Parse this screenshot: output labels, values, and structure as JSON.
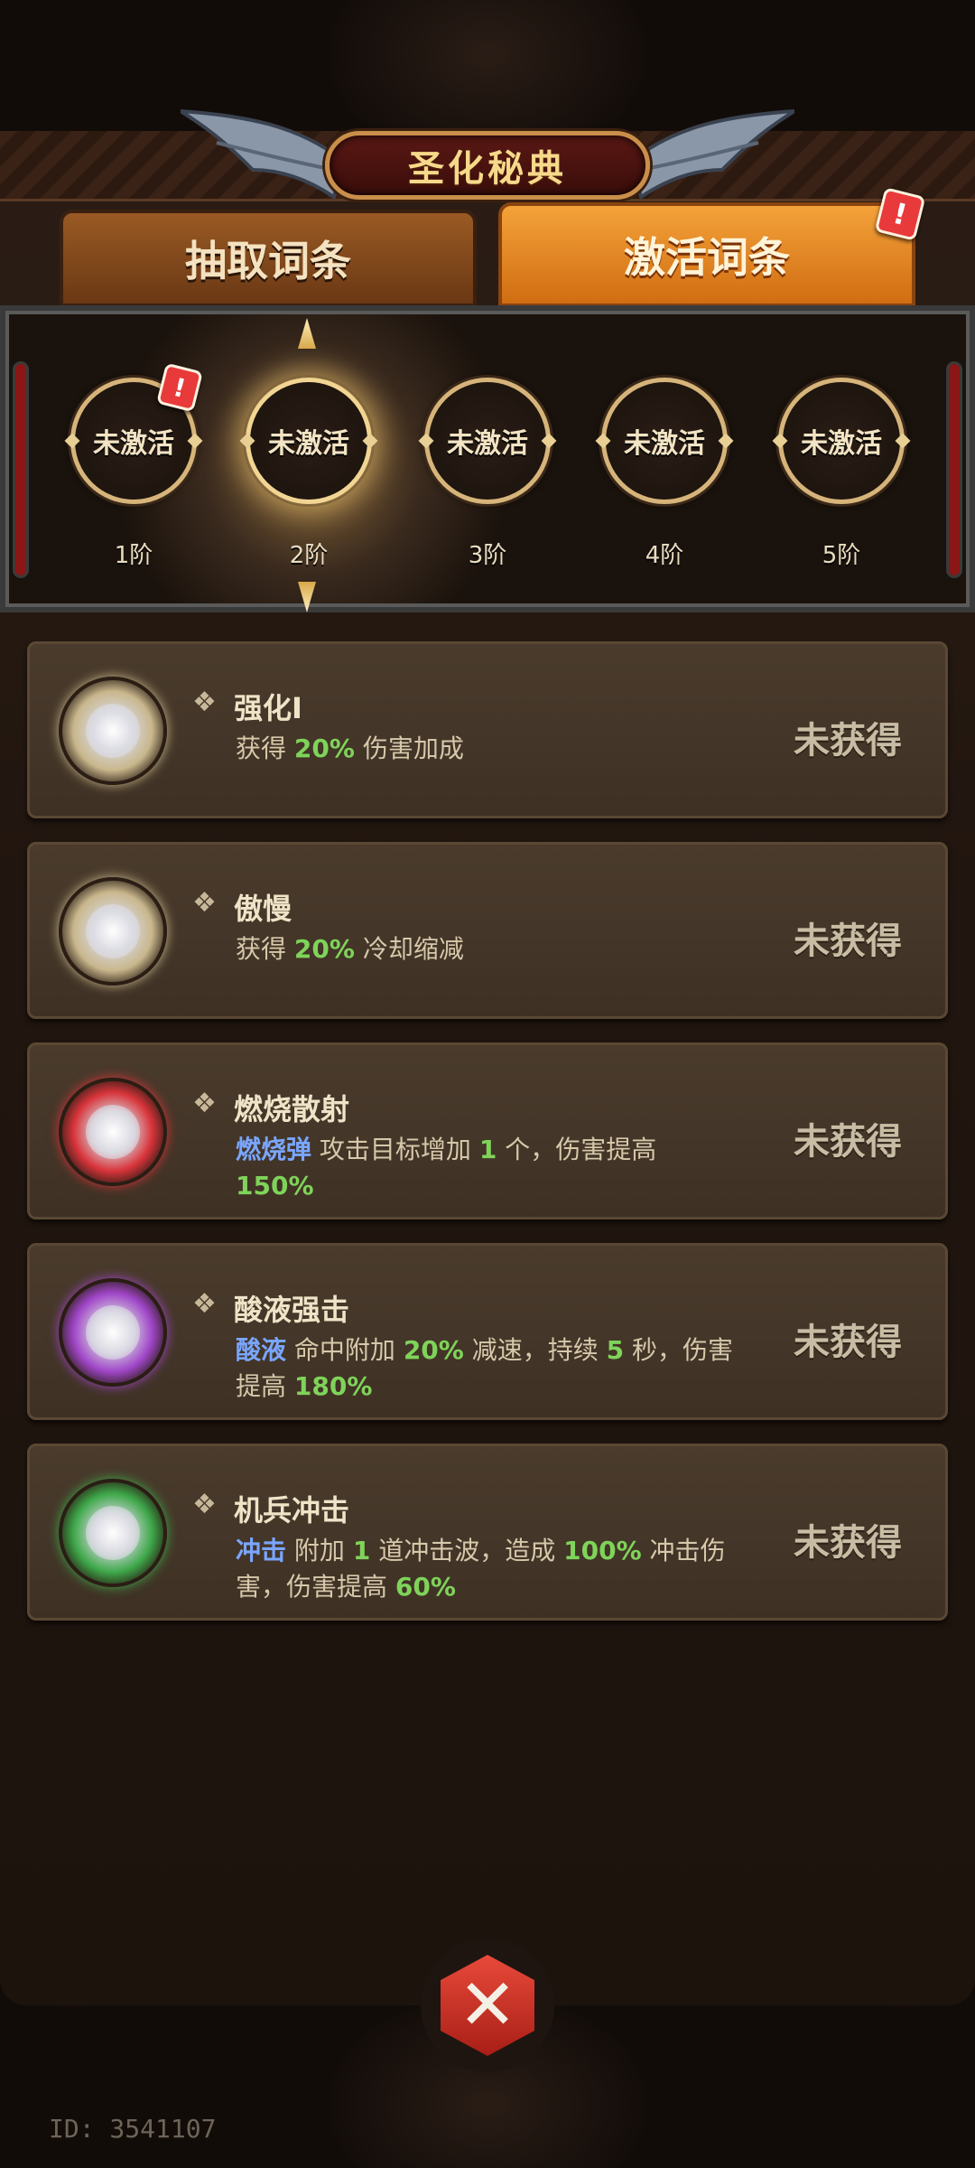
{
  "title": "圣化秘典",
  "tabs": [
    {
      "label": "抽取词条",
      "active": false
    },
    {
      "label": "激活词条",
      "active": true,
      "alert": "!"
    }
  ],
  "stages": [
    {
      "label": "未激活",
      "tier": "1阶",
      "alert": "!",
      "selected": false
    },
    {
      "label": "未激活",
      "tier": "2阶",
      "selected": true
    },
    {
      "label": "未激活",
      "tier": "3阶",
      "selected": false
    },
    {
      "label": "未激活",
      "tier": "4阶",
      "selected": false
    },
    {
      "label": "未激活",
      "tier": "5阶",
      "selected": false
    }
  ],
  "bullet_glyph": "❖",
  "entries": [
    {
      "name": "强化I",
      "orb_color": "#c9b78c",
      "desc": [
        {
          "t": "获得 ",
          "c": ""
        },
        {
          "t": "20%",
          "c": "green"
        },
        {
          "t": " 伤害加成",
          "c": ""
        }
      ],
      "status": "未获得"
    },
    {
      "name": "傲慢",
      "orb_color": "#c9b78c",
      "desc": [
        {
          "t": "获得 ",
          "c": ""
        },
        {
          "t": "20%",
          "c": "green"
        },
        {
          "t": " 冷却缩减",
          "c": ""
        }
      ],
      "status": "未获得"
    },
    {
      "name": "燃烧散射",
      "orb_color": "#d8343a",
      "desc": [
        {
          "t": "燃烧弹",
          "c": "blue"
        },
        {
          "t": " 攻击目标增加 ",
          "c": ""
        },
        {
          "t": "1",
          "c": "green"
        },
        {
          "t": " 个，伤害提高 ",
          "c": ""
        },
        {
          "t": "150%",
          "c": "green"
        }
      ],
      "status": "未获得"
    },
    {
      "name": "酸液强击",
      "orb_color": "#a046c8",
      "desc": [
        {
          "t": "酸液",
          "c": "blue"
        },
        {
          "t": " 命中附加 ",
          "c": ""
        },
        {
          "t": "20%",
          "c": "green"
        },
        {
          "t": " 减速，持续 ",
          "c": ""
        },
        {
          "t": "5",
          "c": "green"
        },
        {
          "t": " 秒，伤害提高 ",
          "c": ""
        },
        {
          "t": "180%",
          "c": "green"
        }
      ],
      "status": "未获得"
    },
    {
      "name": "机兵冲击",
      "orb_color": "#3ea84a",
      "desc": [
        {
          "t": "冲击",
          "c": "blue"
        },
        {
          "t": " 附加 ",
          "c": ""
        },
        {
          "t": "1",
          "c": "green"
        },
        {
          "t": " 道冲击波，造成 ",
          "c": ""
        },
        {
          "t": "100%",
          "c": "green"
        },
        {
          "t": " 冲击伤害，伤害提高 ",
          "c": ""
        },
        {
          "t": "60%",
          "c": "green"
        }
      ],
      "status": "未获得"
    }
  ],
  "close_glyph": "✕",
  "player_id": "ID: 3541107"
}
